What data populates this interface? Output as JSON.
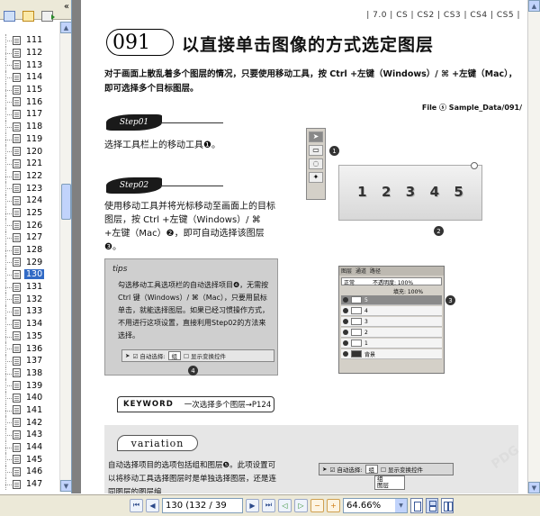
{
  "sidebar": {
    "collapse_glyph": "«",
    "pages": [
      "111",
      "112",
      "113",
      "114",
      "115",
      "116",
      "117",
      "118",
      "119",
      "120",
      "121",
      "122",
      "123",
      "124",
      "125",
      "126",
      "127",
      "128",
      "129",
      "130",
      "131",
      "132",
      "133",
      "134",
      "135",
      "136",
      "137",
      "138",
      "139",
      "140",
      "141",
      "142",
      "143",
      "144",
      "145",
      "146",
      "147"
    ],
    "selected_page": "130"
  },
  "document": {
    "cs_tags": "| 7.0 | CS | CS2 | CS3 | CS4 | CS5 |",
    "chapter_number": "091",
    "chapter_title": "以直接单击图像的方式选定图层",
    "intro": "对于画面上散乱着多个图层的情况，只要使用移动工具，按 Ctrl +左键（Windows）/ ⌘ +左键（Mac），即可选择多个目标图层。",
    "file_ref": "File ⓢ Sample_Data/091/",
    "step1_label": "Step01",
    "step1_text": "选择工具栏上的移动工具❶。",
    "step2_label": "Step02",
    "step2_text": "使用移动工具并将光标移动至画面上的目标图层，按 Ctrl +左键（Windows）/ ⌘ +左键（Mac）❷，即可自动选择该图层❸。",
    "canvas_numbers": [
      "1",
      "2",
      "3",
      "4",
      "5"
    ],
    "callouts": [
      "1",
      "2",
      "3",
      "4"
    ],
    "tips_head": "tips",
    "tips_body": "勾选移动工具选项栏的自动选择项目❹，无需按 Ctrl 键（Windows）/ ⌘（Mac），只要用鼠标单击，就能选择图层。如果已经习惯操作方式，不用进行这项设置，直接利用Step02的方法来选择。",
    "tips_toolbar": {
      "auto_select": "☑ 自动选择:",
      "select_value": "组",
      "transform": "☐ 显示变换控件"
    },
    "layers_panel": {
      "tabs": [
        "图层",
        "通道",
        "路径"
      ],
      "mode": "正常",
      "opacity": "不透明度: 100%",
      "fill": "填充: 100%",
      "layers": [
        "5",
        "4",
        "3",
        "2",
        "1",
        "背景"
      ]
    },
    "keyword_label": "KEYWORD",
    "keyword_text": "一次选择多个图层→P124",
    "variation_title": "variation",
    "variation_text": "自动选择项目的选项包括组和图层❺。此项设置可以将移动工具选择图层时是单独选择图层，还是连同图层的图层编",
    "variation_toolbar": {
      "auto_select": "☑ 自动选择:",
      "select_value": "组",
      "transform": "☐ 显示变换控件",
      "options": [
        "组",
        "图层"
      ]
    },
    "watermark": "PDG"
  },
  "navbar": {
    "page_field": "130 (132 / 39",
    "zoom_field": "64.66%"
  }
}
